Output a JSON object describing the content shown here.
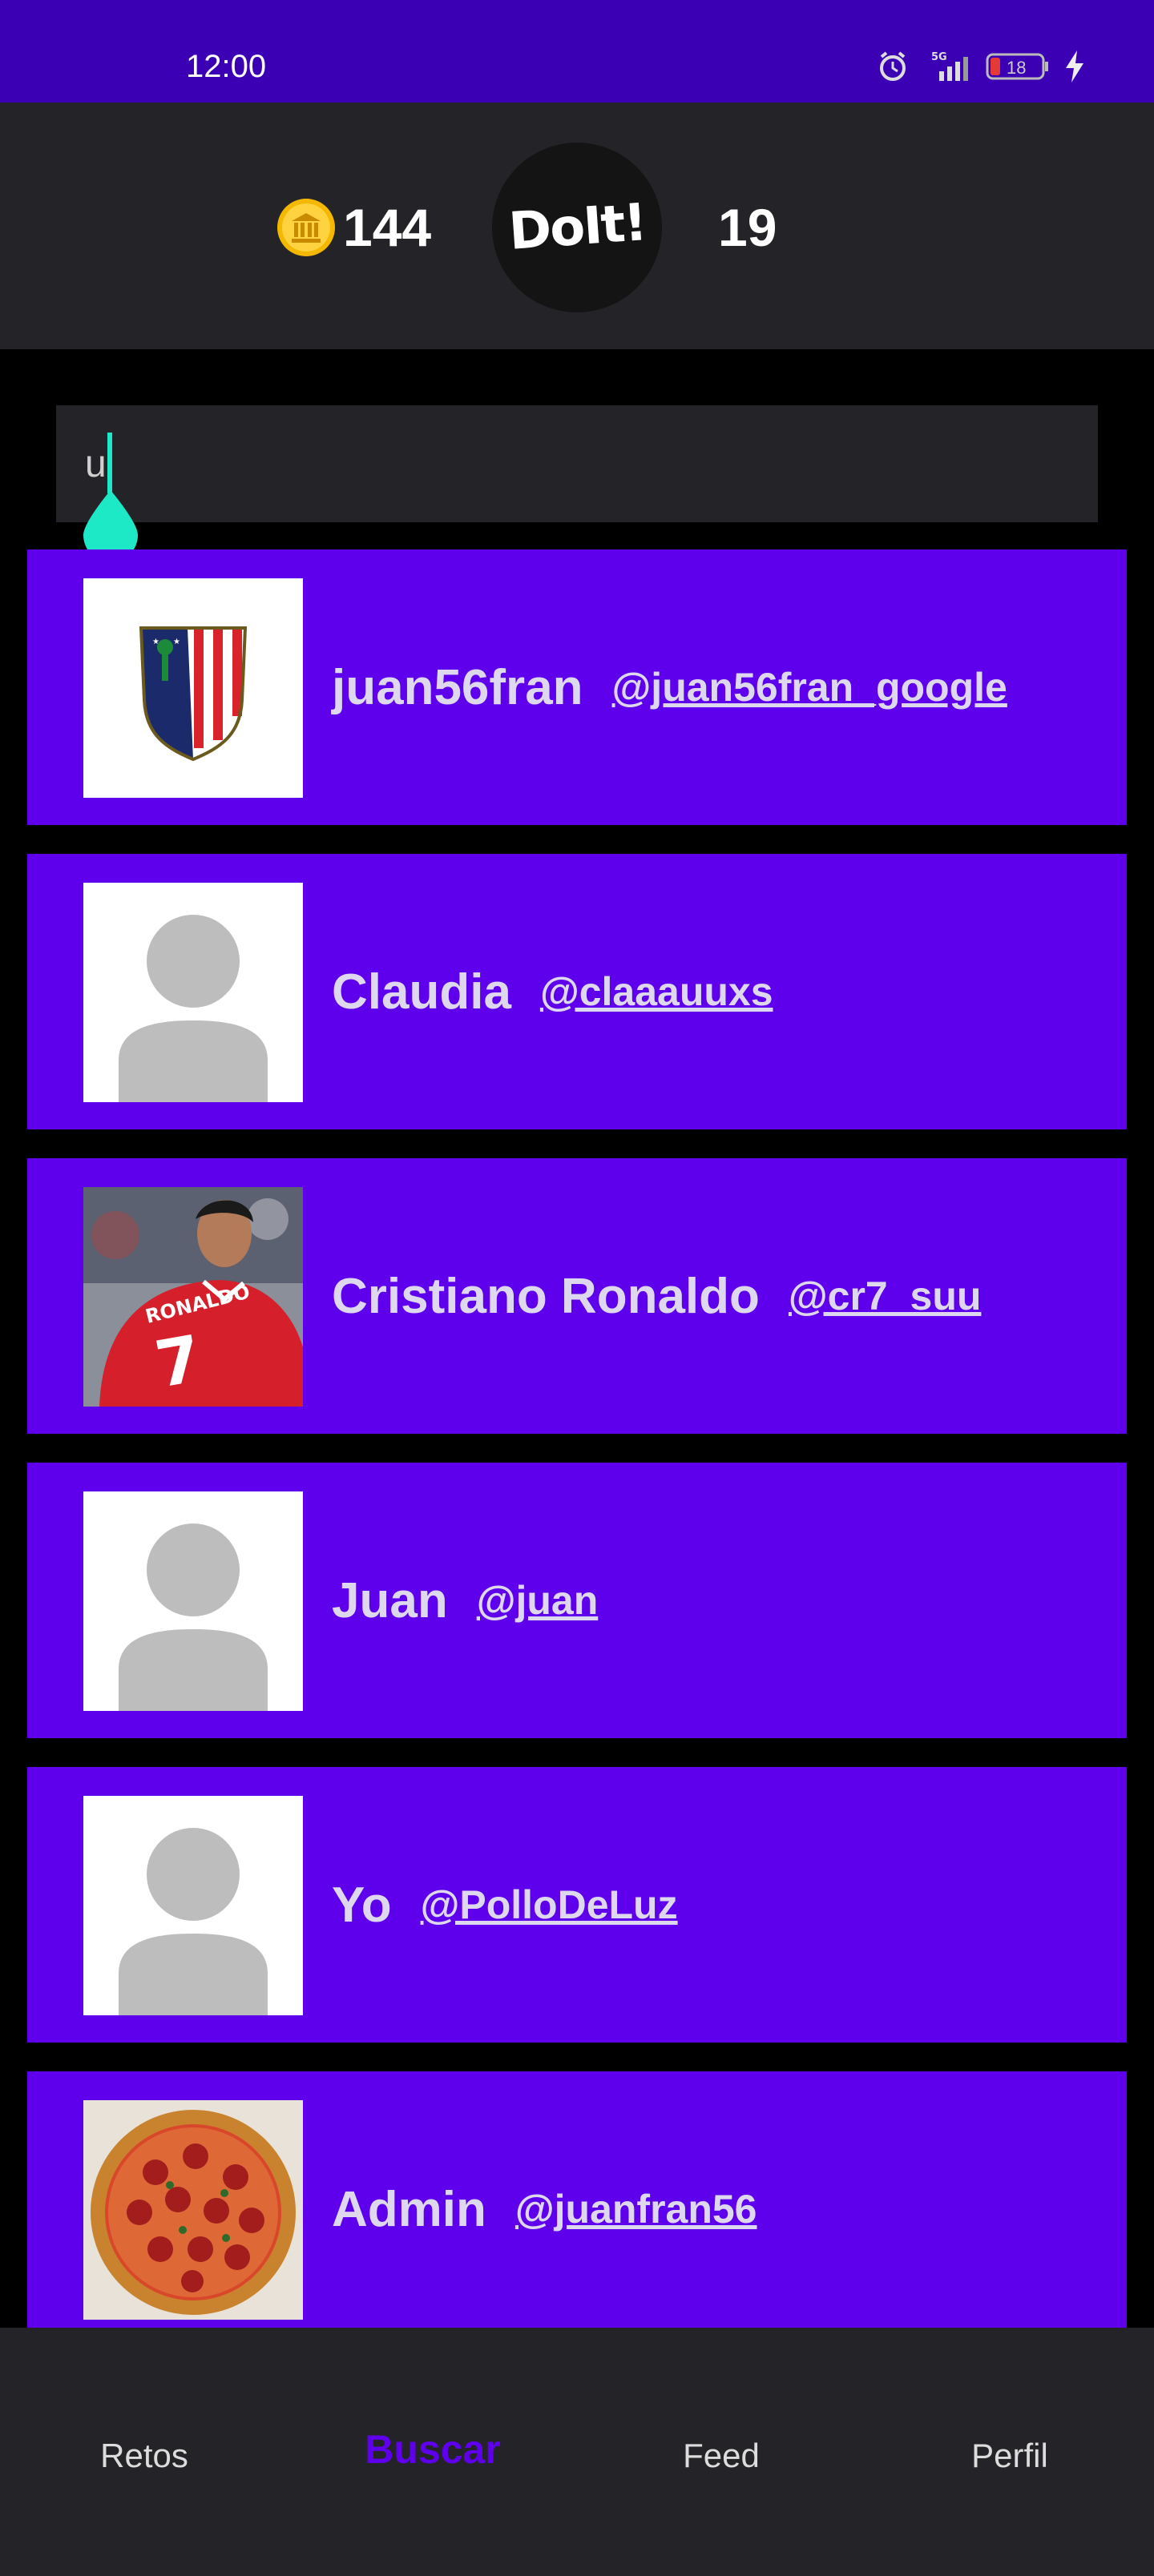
{
  "status_bar": {
    "time": "12:00",
    "network": "5G",
    "battery": "18"
  },
  "header": {
    "coins": "144",
    "logo_text": "DoIt!",
    "streak": "19"
  },
  "search": {
    "value": "u"
  },
  "results": [
    {
      "name": "juan56fran",
      "handle": "@juan56fran_google",
      "avatar": "atletico-crest-avatar"
    },
    {
      "name": "Claudia",
      "handle": "@claaauuxs",
      "avatar": "default-person-avatar"
    },
    {
      "name": "Cristiano Ronaldo",
      "handle": "@cr7_suu",
      "avatar": "ronaldo-photo-avatar",
      "jersey_name": "RONALDO",
      "jersey_number": "7"
    },
    {
      "name": "Juan",
      "handle": "@juan",
      "avatar": "default-person-avatar"
    },
    {
      "name": "Yo",
      "handle": "@PolloDeLuz",
      "avatar": "default-person-avatar"
    },
    {
      "name": "Admin",
      "handle": "@juanfran56",
      "avatar": "pizza-photo-avatar"
    }
  ],
  "nav": {
    "items": [
      "Retos",
      "Buscar",
      "Feed",
      "Perfil"
    ],
    "active": "Buscar"
  },
  "colors": {
    "status_bar": "#3c00b4",
    "accent": "#5e00ec",
    "surface": "#242428",
    "background": "#000000",
    "caret": "#1de9c6"
  }
}
